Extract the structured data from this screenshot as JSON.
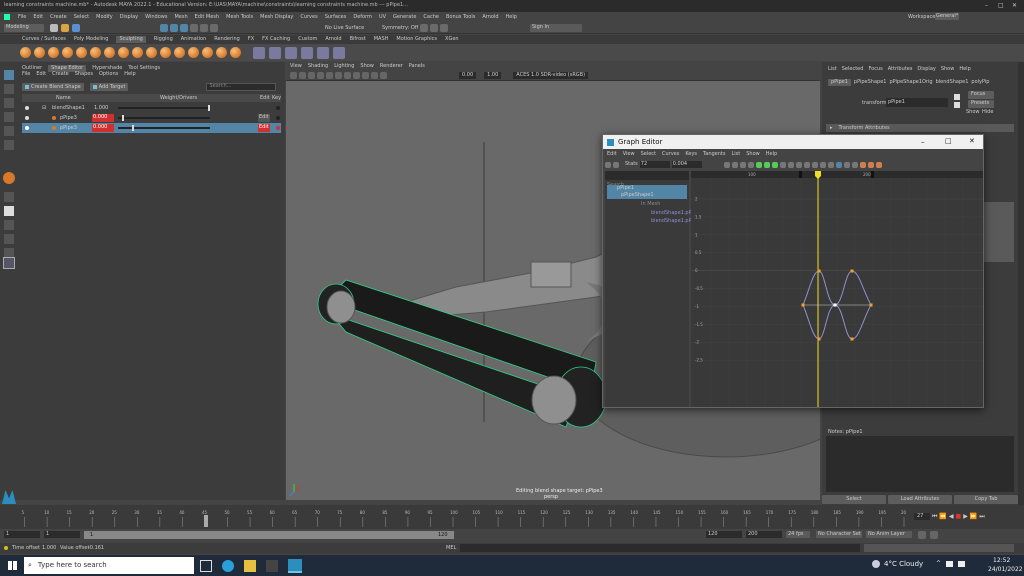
{
  "window": {
    "title": "learning constraints machine.mb* - Autodesk MAYA 2022.1 - Educational Version: E:\\UAS\\MAYA\\machine\\constraints\\learning constraints machine.mb  ---  pPipe1...",
    "workspace_label": "Workspace:",
    "workspace_value": "General*"
  },
  "menu": [
    "File",
    "Edit",
    "Create",
    "Select",
    "Modify",
    "Display",
    "Windows",
    "Mesh",
    "Edit Mesh",
    "Mesh Tools",
    "Mesh Display",
    "Curves",
    "Surfaces",
    "Deform",
    "UV",
    "Generate",
    "Cache",
    "Bonus Tools",
    "Arnold",
    "Help"
  ],
  "status": {
    "mode": "Modeling",
    "no_live_surface": "No Live Surface",
    "symmetry": "Symmetry: Off",
    "sign_in": "Sign In"
  },
  "shelf_tabs": [
    "Curves / Surfaces",
    "Poly Modeling",
    "Sculpting",
    "Rigging",
    "Animation",
    "Rendering",
    "FX",
    "FX Caching",
    "Custom",
    "Arnold",
    "Bifrost",
    "MASH",
    "Motion Graphics",
    "XGen"
  ],
  "shelf_active": "Sculpting",
  "shape_editor": {
    "tabs": [
      "Outliner",
      "Shape Editor",
      "Hypershade",
      "Tool Settings"
    ],
    "active_tab": "Shape Editor",
    "menu": [
      "File",
      "Edit",
      "Create",
      "Shapes",
      "Options",
      "Help"
    ],
    "create_button": "Create Blend Shape",
    "add_target_button": "Add Target",
    "search_placeholder": "Search...",
    "columns": [
      "Name",
      "Weight/Drivers",
      "Edit",
      "Key"
    ],
    "rows": [
      {
        "name": "blendShape1",
        "weight": "1.000",
        "edit": "",
        "selected": false
      },
      {
        "name": "pPipe3",
        "weight": "0.000",
        "edit": "Edit",
        "selected": false
      },
      {
        "name": "pPipe3",
        "weight": "0.000",
        "edit": "Edit",
        "selected": true
      }
    ]
  },
  "viewport": {
    "menu": [
      "View",
      "Shading",
      "Lighting",
      "Show",
      "Renderer",
      "Panels"
    ],
    "near": "0.00",
    "far": "1.00",
    "colorspace": "ACES 1.0 SDR-video (sRGB)",
    "hud_line1": "Editing blend shape target: pPipe3",
    "hud_line2": "persp"
  },
  "attr_editor": {
    "menu": [
      "List",
      "Selected",
      "Focus",
      "Attributes",
      "Display",
      "Show",
      "Help"
    ],
    "tabs": [
      "pPipe1",
      "pPipeShape1",
      "pPipeShape1Orig",
      "blendShape1",
      "polyPip"
    ],
    "transform_label": "transform:",
    "transform_value": "pPipe1",
    "focus": "Focus",
    "presets": "Presets",
    "show": "Show",
    "hide": "Hide",
    "section": "Transform Attributes",
    "notes_label": "Notes:  pPipe1",
    "select_btn": "Select",
    "load_btn": "Load Attributes",
    "copy_btn": "Copy Tab"
  },
  "graph_editor": {
    "title": "Graph Editor",
    "menu": [
      "Edit",
      "View",
      "Select",
      "Curves",
      "Keys",
      "Tangents",
      "List",
      "Show",
      "Help"
    ],
    "stats_label": "Stats",
    "stats_v1": "72",
    "stats_v2": "0.004",
    "search_placeholder": "Search...",
    "outliner": [
      "pPipe1",
      "pPipeShape1",
      "In Mesh",
      "blendShape1.pPipe3",
      "blendShape1.pPipe3"
    ],
    "y_ticks": [
      "2",
      "1.5",
      "1",
      "0.5",
      "0",
      "-0.5",
      "-1",
      "-1.5",
      "-2",
      "-2.5"
    ],
    "x_ticks": [
      "100",
      "200"
    ],
    "current_frame": 127
  },
  "timeline": {
    "ticks": [
      "5",
      "10",
      "15",
      "20",
      "25",
      "30",
      "35",
      "40",
      "45",
      "50",
      "55",
      "60",
      "65",
      "70",
      "75",
      "80",
      "85",
      "90",
      "95",
      "100",
      "105",
      "110",
      "115",
      "120",
      "125",
      "130",
      "135",
      "140",
      "145",
      "150",
      "155",
      "160",
      "165",
      "170",
      "175",
      "180",
      "185",
      "190",
      "195",
      "200"
    ],
    "current": "27"
  },
  "range": {
    "start": "1",
    "start2": "1",
    "slider_value": "1",
    "end_inner": "120",
    "end": "120",
    "end2": "200",
    "fps": "24 fps",
    "char_set": "No Character Set",
    "anim_layer": "No Anim Layer"
  },
  "cmdline": {
    "time_offset": "Time offset",
    "time_offset_val": "1.000",
    "value_offset": "Value offset",
    "value_offset_val": "-0.161",
    "mel": "MEL"
  },
  "taskbar": {
    "search": "Type here to search",
    "weather": "4°C  Cloudy",
    "time": "12:52",
    "date": "24/01/2022"
  },
  "colors": {
    "accent_blue": "#5285a6",
    "highlight": "#6cc4e8",
    "active_tab": "#5d5d5d",
    "curve_color": "#8f8fd0",
    "key_color": "#f0a030",
    "current_frame_line": "#f0e020",
    "selection_green": "#2fcf8f"
  }
}
